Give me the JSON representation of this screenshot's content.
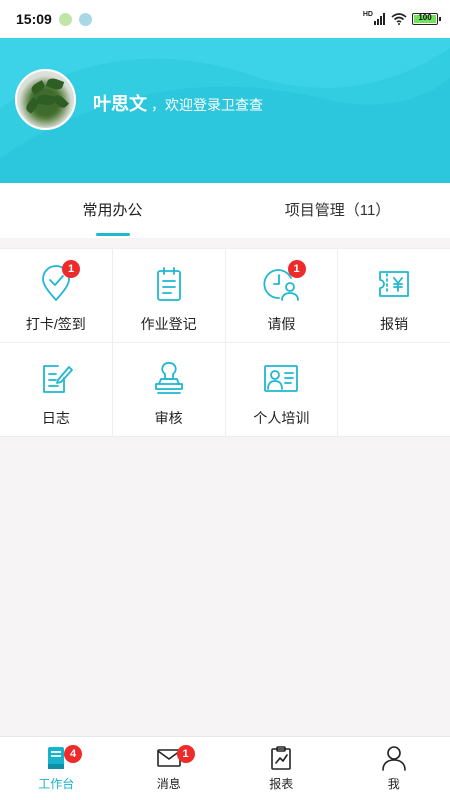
{
  "status_bar": {
    "time": "15:09",
    "network_label": "HD",
    "battery_level": "100",
    "dot_colors": [
      "#bfe6a6",
      "#a8d8e6"
    ]
  },
  "header": {
    "user_name": "叶思文",
    "welcome_text": "，欢迎登录卫查查",
    "background_color": "#2cc7dd"
  },
  "tabs": [
    {
      "label": "常用办公",
      "count": "",
      "active": true
    },
    {
      "label": "项目管理",
      "count": "（11）",
      "active": false
    }
  ],
  "grid": {
    "accent_color": "#1fb8d0",
    "items": [
      {
        "label": "打卡/签到",
        "icon": "location-check-icon",
        "badge": "1"
      },
      {
        "label": "作业登记",
        "icon": "clipboard-icon",
        "badge": ""
      },
      {
        "label": "请假",
        "icon": "clock-person-icon",
        "badge": "1"
      },
      {
        "label": "报销",
        "icon": "yen-receipt-icon",
        "badge": ""
      },
      {
        "label": "日志",
        "icon": "edit-document-icon",
        "badge": ""
      },
      {
        "label": "审核",
        "icon": "stamp-icon",
        "badge": ""
      },
      {
        "label": "个人培训",
        "icon": "training-board-icon",
        "badge": ""
      }
    ]
  },
  "bottom_nav": [
    {
      "label": "工作台",
      "icon": "workbench-book-icon",
      "badge": "4",
      "active": true
    },
    {
      "label": "消息",
      "icon": "mail-icon",
      "badge": "1",
      "active": false
    },
    {
      "label": "报表",
      "icon": "report-clipboard-icon",
      "badge": "",
      "active": false
    },
    {
      "label": "我",
      "icon": "person-icon",
      "badge": "",
      "active": false
    }
  ]
}
